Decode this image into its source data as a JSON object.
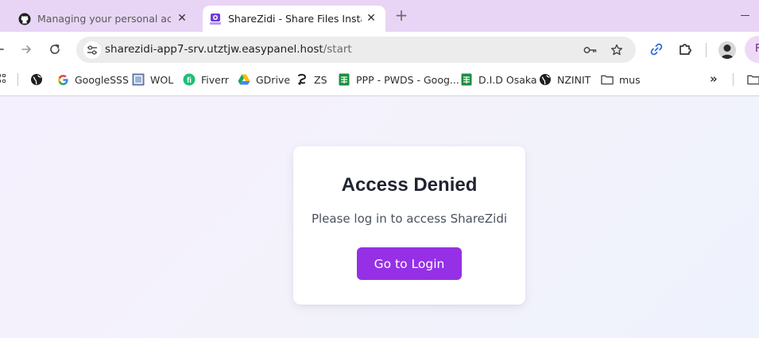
{
  "tabs": [
    {
      "title": "Managing your personal access tokens - GitHub Docs",
      "icon": "github-icon",
      "active": false
    },
    {
      "title": "ShareZidi - Share Files Instantly",
      "icon": "sharezidi-logo-icon",
      "active": true
    }
  ],
  "new_tab_label": "+",
  "address_bar": {
    "host": "sharezidi-app7-srv.utztjw.easypanel.host",
    "path": "/start"
  },
  "profile_initial": "F",
  "bookmarks": [
    {
      "label": "",
      "icon": "globe-icon"
    },
    {
      "label": "GoogleSSS",
      "icon": "google-icon"
    },
    {
      "label": "WOL",
      "icon": "frame-icon"
    },
    {
      "label": "Fiverr",
      "icon": "fiverr-icon"
    },
    {
      "label": "GDrive",
      "icon": "gdrive-icon"
    },
    {
      "label": "ZS",
      "icon": "zs-icon"
    },
    {
      "label": "PPP - PWDS - Goog...",
      "icon": "sheets-icon"
    },
    {
      "label": "D.I.D Osaka",
      "icon": "sheets-icon"
    },
    {
      "label": "NZINIT",
      "icon": "globe-icon"
    },
    {
      "label": "mus",
      "icon": "folder-icon"
    }
  ],
  "bookmarks_overflow": "»",
  "card": {
    "title": "Access Denied",
    "message": "Please log in to access ShareZidi",
    "button_label": "Go to Login"
  },
  "colors": {
    "tab_strip": "#e8d5f5",
    "accent_button": "#9530e6",
    "page_bg": "#f3f2fb"
  }
}
